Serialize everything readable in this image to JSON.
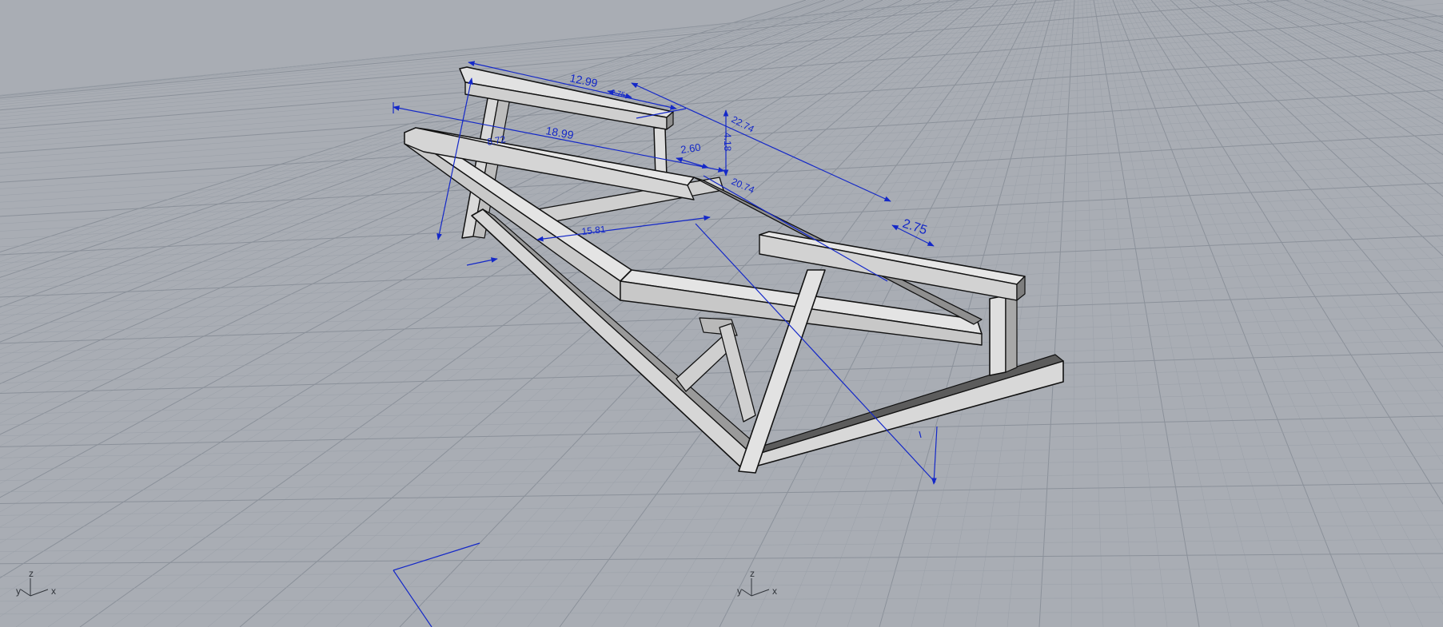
{
  "viewport": {
    "name": "perspective-viewport",
    "background": "#a9adb4",
    "grid_minor_color": "#9aa0a8",
    "grid_major_color": "#8b919a",
    "dimension_color": "#1428c8",
    "frame_fill": "#e2e2e2",
    "frame_edge": "#111111"
  },
  "dimensions": [
    {
      "id": "dim-12-99",
      "label": "12.99"
    },
    {
      "id": "dim-2-75-small",
      "label": "2.75"
    },
    {
      "id": "dim-18-99",
      "label": "18.99"
    },
    {
      "id": "dim-22-74",
      "label": "22.74"
    },
    {
      "id": "dim-4-18",
      "label": "4.18"
    },
    {
      "id": "dim-2-60",
      "label": "2.60"
    },
    {
      "id": "dim-20-74",
      "label": "20.74"
    },
    {
      "id": "dim-2-75",
      "label": "2.75"
    },
    {
      "id": "dim-8-72",
      "label": "8.72"
    },
    {
      "id": "dim-15-81",
      "label": "15.81"
    }
  ],
  "axis_widgets": [
    {
      "id": "axis-widget-left",
      "z": "z",
      "y": "y",
      "x": "x"
    },
    {
      "id": "axis-widget-center",
      "z": "z",
      "y": "y",
      "x": "x"
    }
  ]
}
